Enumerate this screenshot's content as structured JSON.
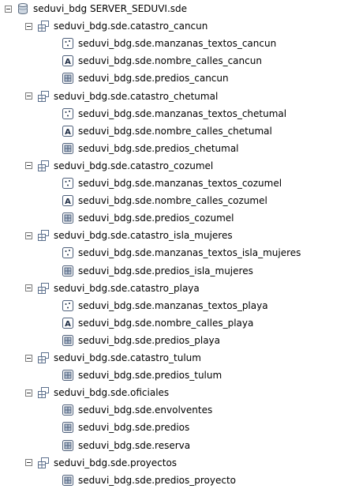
{
  "root": {
    "label": "seduvi_bdg SERVER_SEDUVI.sde",
    "icon": "database-icon"
  },
  "datasets": [
    {
      "label": "seduvi_bdg.sde.catastro_cancun",
      "icon": "feature-dataset-icon",
      "children": [
        {
          "label": "seduvi_bdg.sde.manzanas_textos_cancun",
          "icon": "point-feature-class-icon"
        },
        {
          "label": "seduvi_bdg.sde.nombre_calles_cancun",
          "icon": "annotation-class-icon"
        },
        {
          "label": "seduvi_bdg.sde.predios_cancun",
          "icon": "polygon-feature-class-icon"
        }
      ]
    },
    {
      "label": "seduvi_bdg.sde.catastro_chetumal",
      "icon": "feature-dataset-icon",
      "children": [
        {
          "label": "seduvi_bdg.sde.manzanas_textos_chetumal",
          "icon": "point-feature-class-icon"
        },
        {
          "label": "seduvi_bdg.sde.nombre_calles_chetumal",
          "icon": "annotation-class-icon"
        },
        {
          "label": "seduvi_bdg.sde.predios_chetumal",
          "icon": "polygon-feature-class-icon"
        }
      ]
    },
    {
      "label": "seduvi_bdg.sde.catastro_cozumel",
      "icon": "feature-dataset-icon",
      "children": [
        {
          "label": "seduvi_bdg.sde.manzanas_textos_cozumel",
          "icon": "point-feature-class-icon"
        },
        {
          "label": "seduvi_bdg.sde.nombre_calles_cozumel",
          "icon": "annotation-class-icon"
        },
        {
          "label": "seduvi_bdg.sde.predios_cozumel",
          "icon": "polygon-feature-class-icon"
        }
      ]
    },
    {
      "label": "seduvi_bdg.sde.catastro_isla_mujeres",
      "icon": "feature-dataset-icon",
      "children": [
        {
          "label": "seduvi_bdg.sde.manzanas_textos_isla_mujeres",
          "icon": "point-feature-class-icon"
        },
        {
          "label": "seduvi_bdg.sde.predios_isla_mujeres",
          "icon": "polygon-feature-class-icon"
        }
      ]
    },
    {
      "label": "seduvi_bdg.sde.catastro_playa",
      "icon": "feature-dataset-icon",
      "children": [
        {
          "label": "seduvi_bdg.sde.manzanas_textos_playa",
          "icon": "point-feature-class-icon"
        },
        {
          "label": "seduvi_bdg.sde.nombre_calles_playa",
          "icon": "annotation-class-icon"
        },
        {
          "label": "seduvi_bdg.sde.predios_playa",
          "icon": "polygon-feature-class-icon"
        }
      ]
    },
    {
      "label": "seduvi_bdg.sde.catastro_tulum",
      "icon": "feature-dataset-icon",
      "children": [
        {
          "label": "seduvi_bdg.sde.predios_tulum",
          "icon": "polygon-feature-class-icon"
        }
      ]
    },
    {
      "label": "seduvi_bdg.sde.oficiales",
      "icon": "feature-dataset-icon",
      "children": [
        {
          "label": "seduvi_bdg.sde.envolventes",
          "icon": "polygon-feature-class-icon"
        },
        {
          "label": "seduvi_bdg.sde.predios",
          "icon": "polygon-feature-class-icon"
        },
        {
          "label": "seduvi_bdg.sde.reserva",
          "icon": "polygon-feature-class-icon"
        }
      ]
    },
    {
      "label": "seduvi_bdg.sde.proyectos",
      "icon": "feature-dataset-icon",
      "children": [
        {
          "label": "seduvi_bdg.sde.predios_proyecto",
          "icon": "polygon-feature-class-icon"
        }
      ]
    }
  ]
}
